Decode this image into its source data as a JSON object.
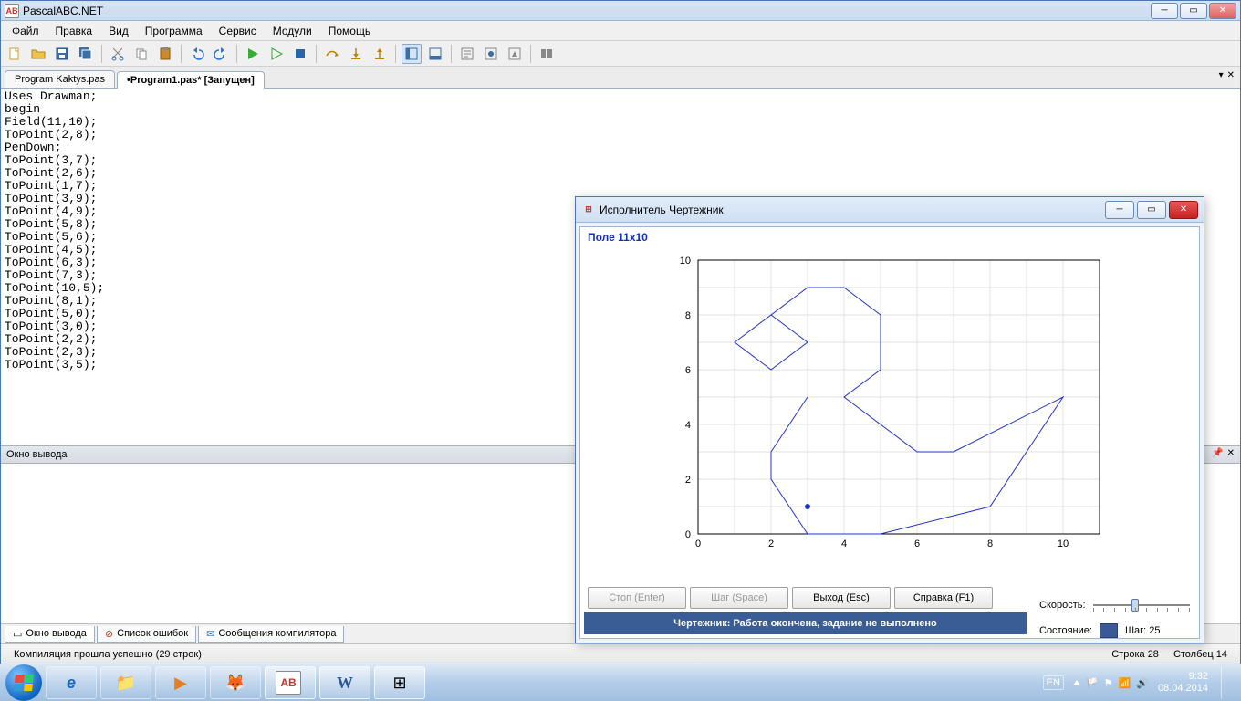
{
  "app": {
    "title": "PascalABC.NET"
  },
  "menu": [
    "Файл",
    "Правка",
    "Вид",
    "Программа",
    "Сервис",
    "Модули",
    "Помощь"
  ],
  "tabs": [
    {
      "label": "Program Kaktys.pas",
      "active": false
    },
    {
      "label": "•Program1.pas* [Запущен]",
      "active": true
    }
  ],
  "code": "Uses Drawman;\nbegin\nField(11,10);\nToPoint(2,8);\nPenDown;\nToPoint(3,7);\nToPoint(2,6);\nToPoint(1,7);\nToPoint(3,9);\nToPoint(4,9);\nToPoint(5,8);\nToPoint(5,6);\nToPoint(4,5);\nToPoint(6,3);\nToPoint(7,3);\nToPoint(10,5);\nToPoint(8,1);\nToPoint(5,0);\nToPoint(3,0);\nToPoint(2,2);\nToPoint(2,3);\nToPoint(3,5);",
  "output_header": "Окно вывода",
  "bottom_tabs": [
    {
      "label": "Окно вывода",
      "icon": "window"
    },
    {
      "label": "Список ошибок",
      "icon": "error"
    },
    {
      "label": "Сообщения компилятора",
      "icon": "msg"
    }
  ],
  "status": {
    "compile": "Компиляция прошла успешно (29 строк)",
    "line_label": "Строка",
    "line": "28",
    "col_label": "Столбец",
    "col": "14"
  },
  "popup": {
    "title": "Исполнитель Чертежник",
    "field_label": "Поле 11x10",
    "buttons": {
      "stop": "Стоп (Enter)",
      "step": "Шаг (Space)",
      "exit": "Выход (Esc)",
      "help": "Справка (F1)"
    },
    "status_msg": "Чертежник: Работа окончена, задание не выполнено",
    "speed_label": "Скорость:",
    "state_label": "Состояние:",
    "step_label": "Шаг: 25"
  },
  "chart_data": {
    "type": "line",
    "title": "",
    "xlabel": "",
    "ylabel": "",
    "xlim": [
      0,
      11
    ],
    "ylim": [
      0,
      10
    ],
    "x_ticks": [
      0,
      2,
      4,
      6,
      8,
      10
    ],
    "y_ticks": [
      0,
      2,
      4,
      6,
      8,
      10
    ],
    "grid": true,
    "series": [
      {
        "name": "path",
        "points": [
          [
            2,
            8
          ],
          [
            3,
            7
          ],
          [
            2,
            6
          ],
          [
            1,
            7
          ],
          [
            3,
            9
          ],
          [
            4,
            9
          ],
          [
            5,
            8
          ],
          [
            5,
            6
          ],
          [
            4,
            5
          ],
          [
            6,
            3
          ],
          [
            7,
            3
          ],
          [
            10,
            5
          ],
          [
            8,
            1
          ],
          [
            5,
            0
          ],
          [
            3,
            0
          ],
          [
            2,
            2
          ],
          [
            2,
            3
          ],
          [
            3,
            5
          ]
        ]
      }
    ],
    "marker": [
      3,
      1
    ]
  },
  "tray": {
    "lang": "EN",
    "time": "9:32",
    "date": "08.04.2014"
  }
}
